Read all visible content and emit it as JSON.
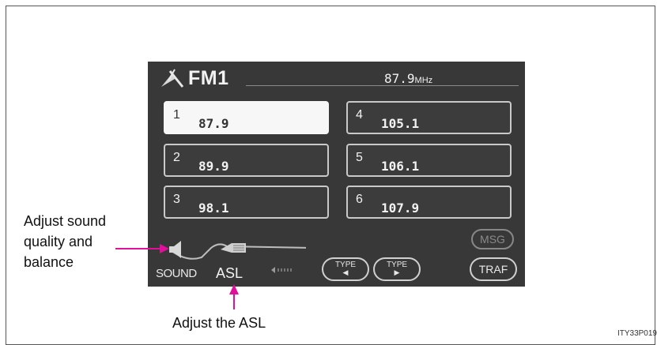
{
  "band": "FM1",
  "frequency": {
    "value": "87.9",
    "unit": "MHz"
  },
  "presets": [
    {
      "num": "1",
      "freq": "87.9"
    },
    {
      "num": "2",
      "freq": "89.9"
    },
    {
      "num": "3",
      "freq": "98.1"
    },
    {
      "num": "4",
      "freq": "105.1"
    },
    {
      "num": "5",
      "freq": "106.1"
    },
    {
      "num": "6",
      "freq": "107.9"
    }
  ],
  "controls": {
    "sound": "SOUND",
    "asl": "ASL",
    "type_label": "TYPE",
    "msg": "MSG",
    "traf": "TRAF"
  },
  "callouts": {
    "sound_line1": "Adjust sound",
    "sound_line2": "quality and",
    "sound_line3": "balance",
    "asl": "Adjust the ASL"
  },
  "figure_code": "ITY33P019",
  "colors": {
    "screen": "#383838",
    "callout_arrow": "#e0109a"
  }
}
